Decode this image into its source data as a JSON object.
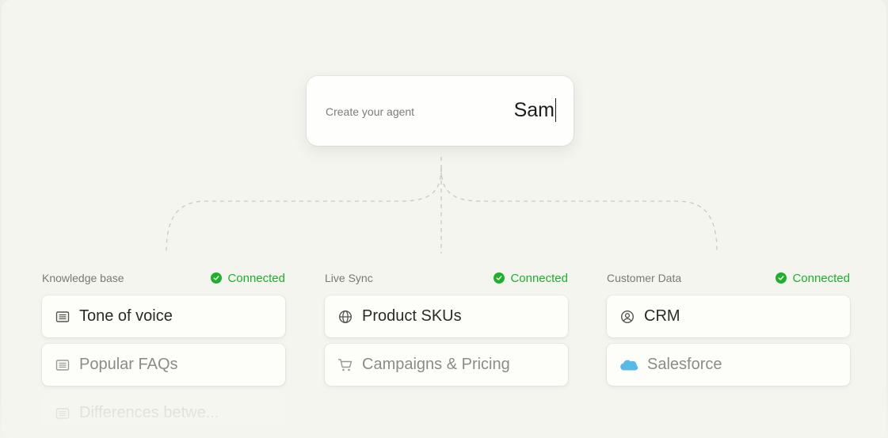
{
  "agent": {
    "label": "Create your agent",
    "name_value": "Sam"
  },
  "columns": [
    {
      "title": "Knowledge base",
      "status": "Connected",
      "items": [
        {
          "label": "Tone of voice",
          "icon": "document-lines-icon"
        },
        {
          "label": "Popular FAQs",
          "icon": "document-lines-icon"
        },
        {
          "label": "Differences betwe...",
          "icon": "document-lines-icon"
        }
      ]
    },
    {
      "title": "Live Sync",
      "status": "Connected",
      "items": [
        {
          "label": "Product SKUs",
          "icon": "globe-icon"
        },
        {
          "label": "Campaigns & Pricing",
          "icon": "shopping-cart-icon"
        }
      ]
    },
    {
      "title": "Customer Data",
      "status": "Connected",
      "items": [
        {
          "label": "CRM",
          "icon": "user-circle-icon"
        },
        {
          "label": "Salesforce",
          "icon": "salesforce-cloud-icon"
        }
      ]
    }
  ],
  "colors": {
    "connected": "#1cb02b",
    "background": "#f5f5f0",
    "salesforce": "#58b8e6"
  }
}
